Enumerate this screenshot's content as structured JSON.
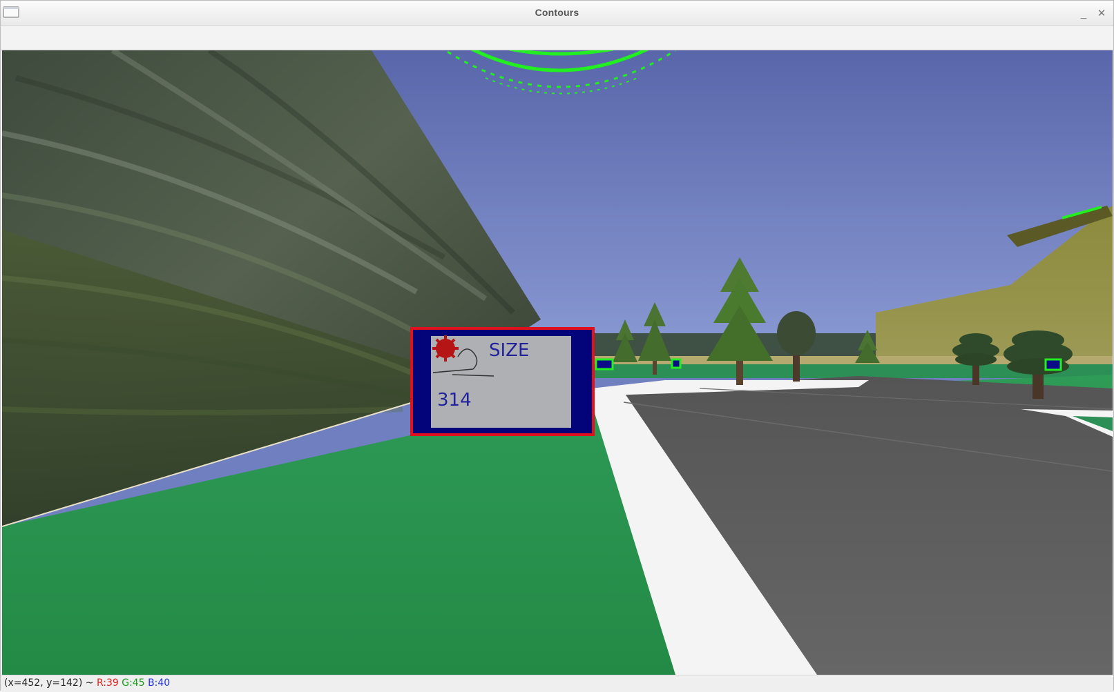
{
  "window": {
    "title": "Contours",
    "menu_icon": "window-menu-icon",
    "minimize_glyph": "_",
    "close_glyph": "✕"
  },
  "scene": {
    "sign": {
      "heading": "SIZE",
      "number": "314",
      "icon": "speed-gear-icon"
    },
    "colors": {
      "sky": "#6a7bbf",
      "grass": "#2a9450",
      "road": "#5c5c5c",
      "contour_green": "#22ee22",
      "sign_border_red": "#e0101c",
      "sign_frame_blue": "#04047a"
    }
  },
  "status": {
    "coords": "(x=452, y=142) ~",
    "r": "R:39",
    "g": "G:45",
    "b": "B:40"
  }
}
